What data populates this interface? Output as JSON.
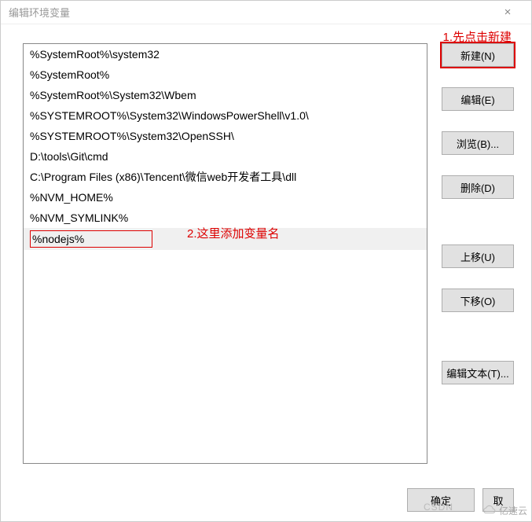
{
  "window": {
    "title": "编辑环境变量",
    "close_glyph": "×"
  },
  "list": {
    "items": [
      "%SystemRoot%\\system32",
      "%SystemRoot%",
      "%SystemRoot%\\System32\\Wbem",
      "%SYSTEMROOT%\\System32\\WindowsPowerShell\\v1.0\\",
      "%SYSTEMROOT%\\System32\\OpenSSH\\",
      "D:\\tools\\Git\\cmd",
      "C:\\Program Files (x86)\\Tencent\\微信web开发者工具\\dll",
      "%NVM_HOME%",
      "%NVM_SYMLINK%"
    ],
    "editing_value": "%nodejs%"
  },
  "buttons": {
    "new": "新建(N)",
    "edit": "编辑(E)",
    "browse": "浏览(B)...",
    "delete": "删除(D)",
    "move_up": "上移(U)",
    "move_down": "下移(O)",
    "edit_text": "编辑文本(T)...",
    "ok": "确定",
    "cancel": "取"
  },
  "annotations": {
    "a1": "1.先点击新建",
    "a2": "2.这里添加变量名"
  },
  "watermark": {
    "csdn": "CSDN",
    "brand": "亿速云"
  }
}
